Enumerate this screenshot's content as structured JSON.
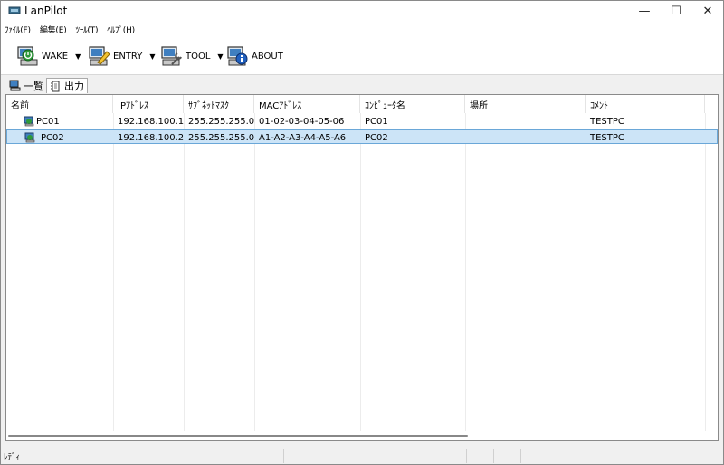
{
  "window": {
    "title": "LanPilot",
    "min_glyph": "—",
    "max_glyph": "☐",
    "close_glyph": "✕"
  },
  "menu": [
    "ﾌｧｲﾙ(F)",
    "編集(E)",
    "ﾂｰﾙ(T)",
    "ﾍﾙﾌﾟ(H)"
  ],
  "toolbar": {
    "wake_label": "WAKE",
    "entry_label": "ENTRY",
    "tool_label": "TOOL",
    "about_label": "ABOUT",
    "dropdown_glyph": "▼"
  },
  "tabs": {
    "list_label": "一覧",
    "output_label": "出力"
  },
  "table": {
    "headers": [
      "名前",
      "IPｱﾄﾞﾚｽ",
      "ｻﾌﾞﾈｯﾄﾏｽｸ",
      "MACｱﾄﾞﾚｽ",
      "ｺﾝﾋﾟｭｰﾀ名",
      "場所",
      "ｺﾒﾝﾄ"
    ],
    "rows": [
      [
        "PC01",
        "192.168.100.1",
        "255.255.255.0",
        "01-02-03-04-05-06",
        "PC01",
        "",
        "TESTPC"
      ],
      [
        "PC02",
        "192.168.100.2",
        "255.255.255.0",
        "A1-A2-A3-A4-A5-A6",
        "PC02",
        "",
        "TESTPC"
      ]
    ],
    "selected_row": 1
  },
  "status": {
    "text": "ﾚﾃﾞｨ"
  },
  "colors": {
    "selection_bg": "#cce4f7",
    "selection_border": "#6aa7d8"
  }
}
